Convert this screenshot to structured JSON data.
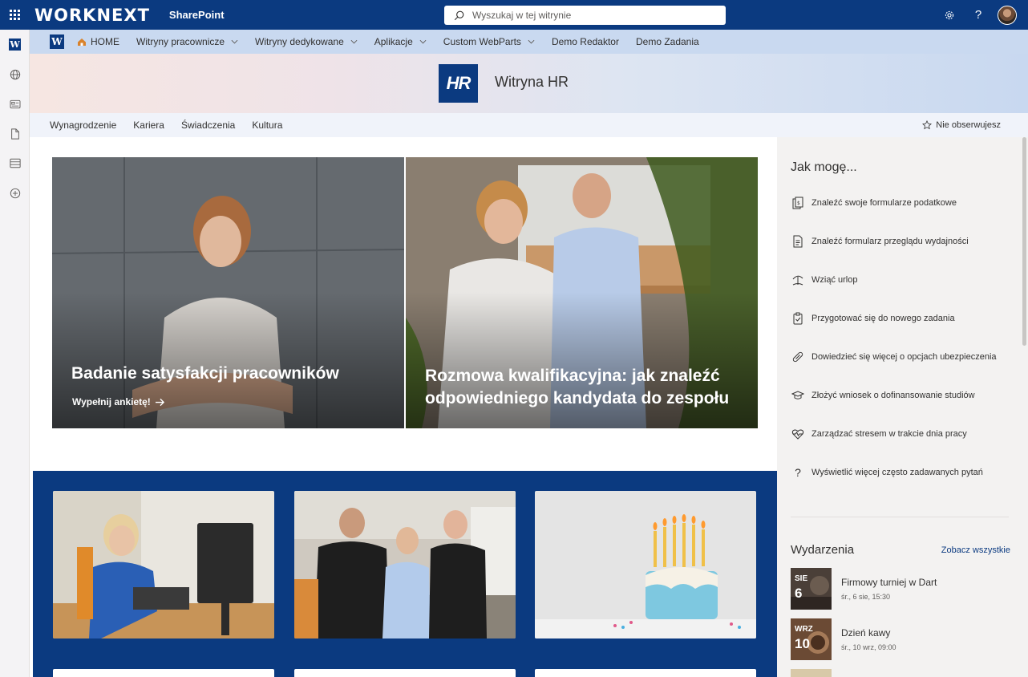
{
  "suite": {
    "brand": "WORKNEXT",
    "app_name": "SharePoint",
    "search_placeholder": "Wyszukaj w tej witrynie",
    "settings_icon": "gear-icon",
    "help_label": "?"
  },
  "appbar": {
    "items": [
      "worknext-logo-icon",
      "globe-icon",
      "news-icon",
      "document-icon",
      "list-icon",
      "add-icon"
    ],
    "logo_letter": "W"
  },
  "hubnav": {
    "logo_letter": "W",
    "items": [
      {
        "label": "HOME",
        "has_dropdown": false
      },
      {
        "label": "Witryny pracownicze",
        "has_dropdown": true
      },
      {
        "label": "Witryny dedykowane",
        "has_dropdown": true
      },
      {
        "label": "Aplikacje",
        "has_dropdown": true
      },
      {
        "label": "Custom WebParts",
        "has_dropdown": true
      },
      {
        "label": "Demo Redaktor",
        "has_dropdown": false
      },
      {
        "label": "Demo Zadania",
        "has_dropdown": false
      }
    ]
  },
  "site": {
    "logo_text": "HR",
    "title": "Witryna HR"
  },
  "sitenav": {
    "items": [
      "Wynagrodzenie",
      "Kariera",
      "Świadczenia",
      "Kultura"
    ],
    "follow_label": "Nie obserwujesz"
  },
  "hero": {
    "tiles": [
      {
        "title": "Badanie satysfakcji pracowników",
        "link": "Wypełnij ankietę!"
      },
      {
        "title": "Rozmowa kwalifikacyjna: jak znaleźć odpowiedniego kandydata do zespołu",
        "link": ""
      }
    ]
  },
  "quicklinks": {
    "title": "Jak mogę...",
    "items": [
      {
        "label": "Znaleźć swoje formularze podatkowe",
        "icon": "tax-form-icon"
      },
      {
        "label": "Znaleźć formularz przeglądu wydajności",
        "icon": "document-icon"
      },
      {
        "label": "Wziąć urlop",
        "icon": "beach-icon"
      },
      {
        "label": "Przygotować się do nowego zadania",
        "icon": "clipboard-check-icon"
      },
      {
        "label": "Dowiedzieć się więcej o opcjach ubezpieczenia",
        "icon": "pill-icon"
      },
      {
        "label": "Złożyć wniosek o dofinansowanie studiów",
        "icon": "graduation-cap-icon"
      },
      {
        "label": "Zarządzać stresem w trakcie dnia pracy",
        "icon": "heart-pulse-icon"
      },
      {
        "label": "Wyświetlić więcej często zadawanych pytań",
        "icon": "question-icon"
      }
    ]
  },
  "events": {
    "title": "Wydarzenia",
    "see_all": "Zobacz wszystkie",
    "items": [
      {
        "month": "SIE",
        "day": "6",
        "name": "Firmowy turniej w Dart",
        "date": "śr., 6 sie, 15:30"
      },
      {
        "month": "WRZ",
        "day": "10",
        "name": "Dzień kawy",
        "date": "śr., 10 wrz, 09:00"
      }
    ]
  },
  "colors": {
    "brand": "#0b3a80",
    "hub_bg": "#c9d9f0",
    "rail_bg": "#f3f2f1"
  }
}
